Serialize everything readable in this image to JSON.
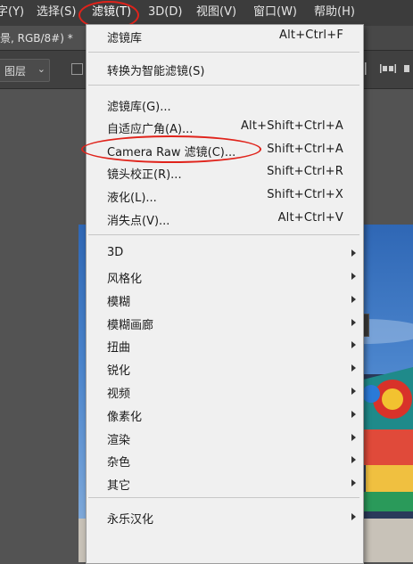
{
  "menubar": {
    "items": [
      {
        "label": "字(Y)"
      },
      {
        "label": "选择(S)"
      },
      {
        "label": "滤镜(T)"
      },
      {
        "label": "3D(D)"
      },
      {
        "label": "视图(V)"
      },
      {
        "label": "窗口(W)"
      },
      {
        "label": "帮助(H)"
      }
    ]
  },
  "document_tab": {
    "label": "景, RGB/8#) *"
  },
  "options_bar": {
    "layer_select": "图层",
    "layer_select_caret": "⌄"
  },
  "filter_menu": {
    "items": [
      {
        "label": "滤镜库",
        "shortcut": "Alt+Ctrl+F",
        "submenu": false
      },
      {
        "label": "转换为智能滤镜(S)",
        "shortcut": "",
        "submenu": false
      },
      {
        "label": "滤镜库(G)...",
        "shortcut": "",
        "submenu": false
      },
      {
        "label": "自适应广角(A)...",
        "shortcut": "Alt+Shift+Ctrl+A",
        "submenu": false
      },
      {
        "label": "Camera Raw 滤镜(C)...",
        "shortcut": "Shift+Ctrl+A",
        "submenu": false
      },
      {
        "label": "镜头校正(R)...",
        "shortcut": "Shift+Ctrl+R",
        "submenu": false
      },
      {
        "label": "液化(L)...",
        "shortcut": "Shift+Ctrl+X",
        "submenu": false
      },
      {
        "label": "消失点(V)...",
        "shortcut": "Alt+Ctrl+V",
        "submenu": false
      },
      {
        "label": "3D",
        "shortcut": "",
        "submenu": true
      },
      {
        "label": "风格化",
        "shortcut": "",
        "submenu": true
      },
      {
        "label": "模糊",
        "shortcut": "",
        "submenu": true
      },
      {
        "label": "模糊画廊",
        "shortcut": "",
        "submenu": true
      },
      {
        "label": "扭曲",
        "shortcut": "",
        "submenu": true
      },
      {
        "label": "锐化",
        "shortcut": "",
        "submenu": true
      },
      {
        "label": "视频",
        "shortcut": "",
        "submenu": true
      },
      {
        "label": "像素化",
        "shortcut": "",
        "submenu": true
      },
      {
        "label": "渲染",
        "shortcut": "",
        "submenu": true
      },
      {
        "label": "杂色",
        "shortcut": "",
        "submenu": true
      },
      {
        "label": "其它",
        "shortcut": "",
        "submenu": true
      },
      {
        "label": "永乐汉化",
        "shortcut": "",
        "submenu": true
      }
    ]
  },
  "colors": {
    "highlight": "#e0231b",
    "menubar_bg": "#3c3c3c",
    "menu_bg": "#f0f0f0"
  }
}
